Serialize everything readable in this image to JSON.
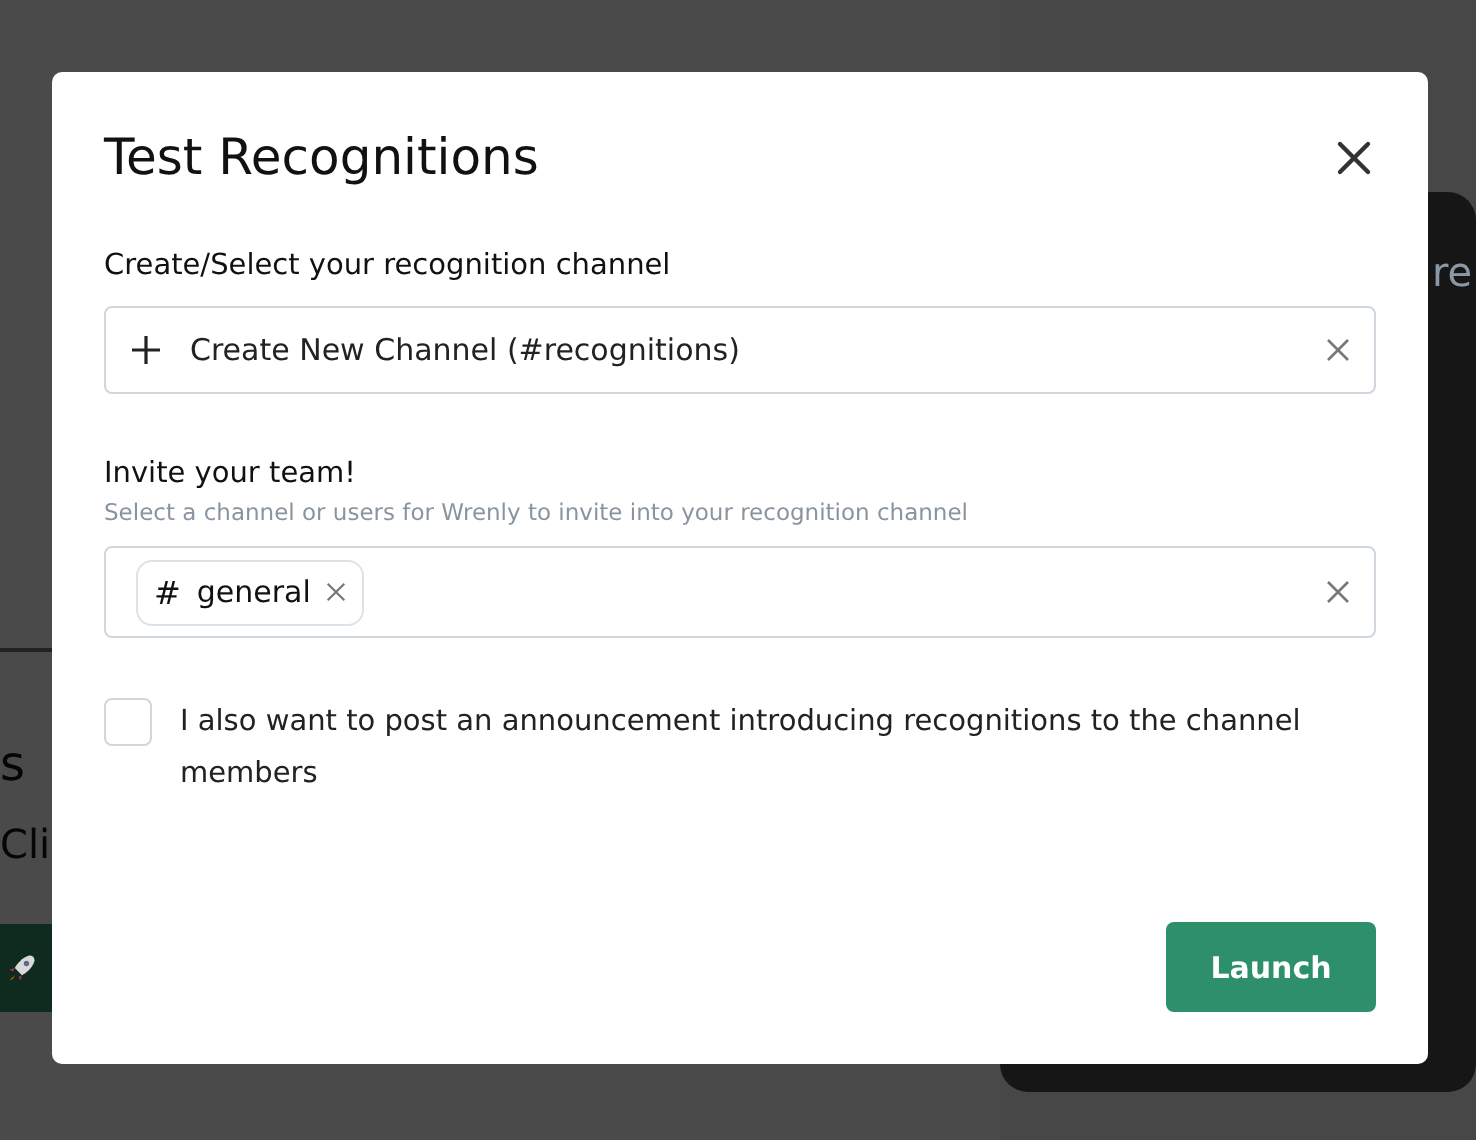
{
  "background": {
    "left_heading": "s",
    "left_text": "Cli",
    "right_heading": "re"
  },
  "modal": {
    "title": "Test Recognitions",
    "channel_field": {
      "label": "Create/Select your recognition channel",
      "value": "Create New Channel (#recognitions)"
    },
    "invite_field": {
      "label": "Invite your team!",
      "hint": "Select a channel or users for Wrenly to invite into your recognition channel",
      "chips": [
        {
          "prefix": "#",
          "label": "general"
        }
      ]
    },
    "announcement": {
      "checked": false,
      "label": "I also want to post an announcement introducing recognitions to the channel members"
    },
    "launch_button": "Launch"
  }
}
